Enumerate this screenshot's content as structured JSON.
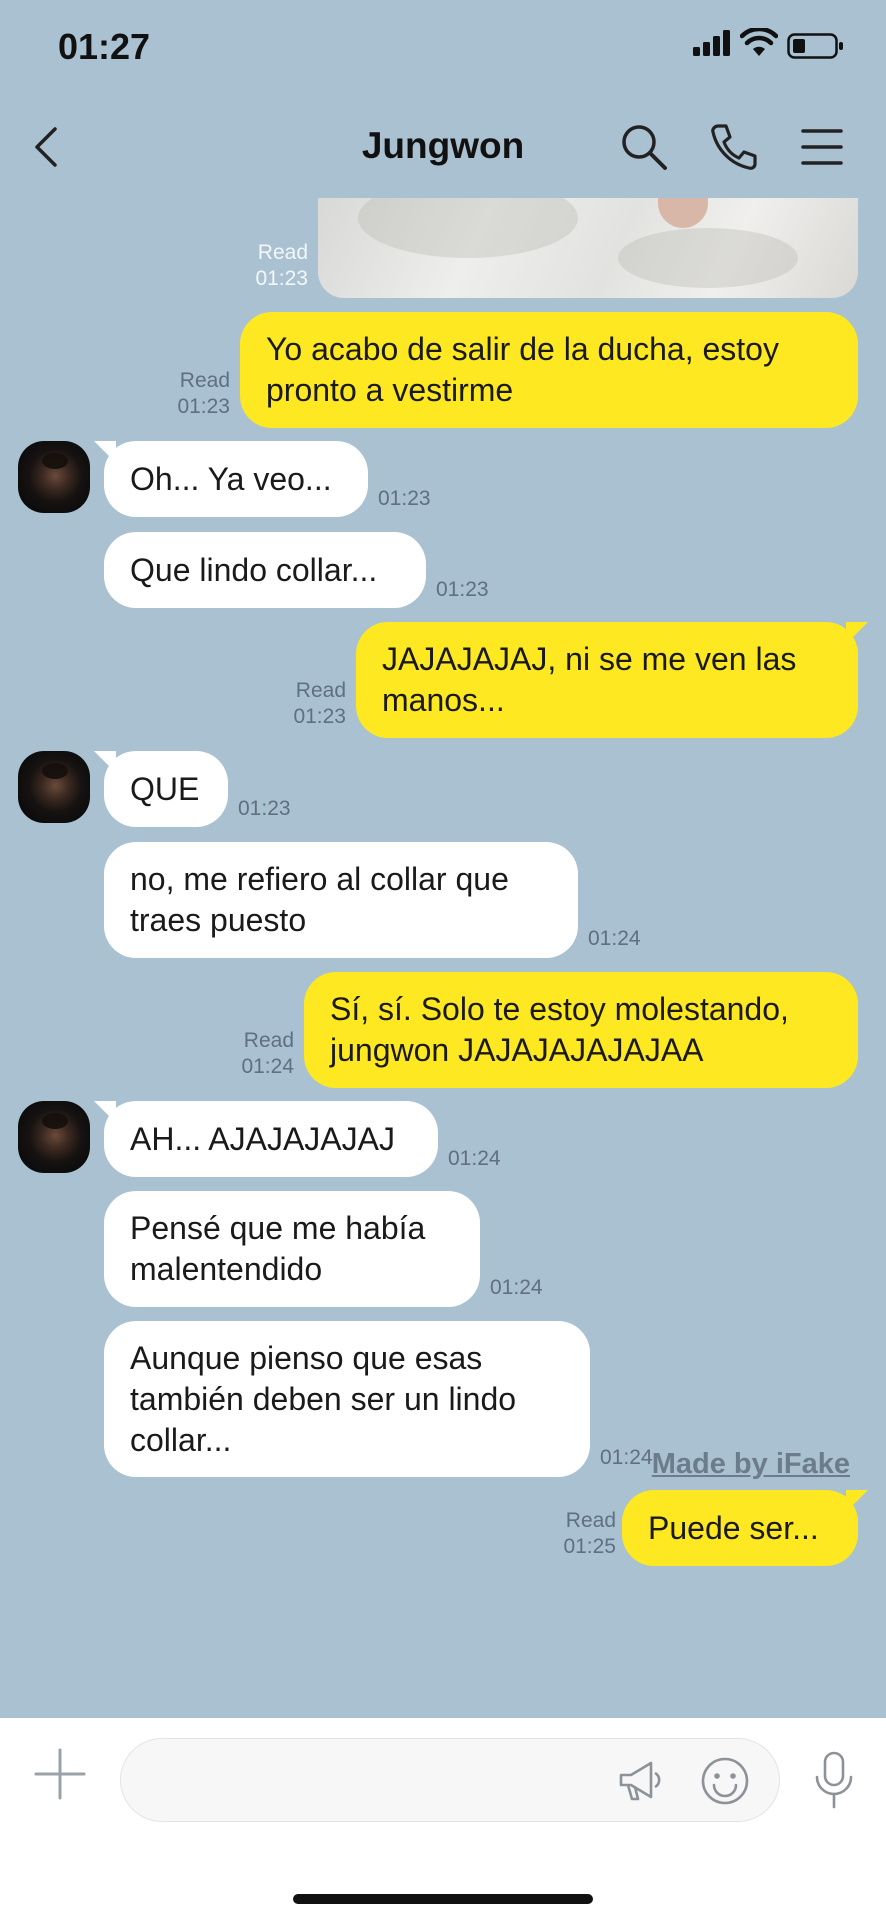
{
  "status_bar": {
    "time": "01:27"
  },
  "header": {
    "contact_name": "Jungwon"
  },
  "messages": [
    {
      "dir": "out",
      "type": "photo",
      "read": "Read",
      "time": "01:23"
    },
    {
      "dir": "out",
      "text": "Yo acabo de salir de la ducha, estoy pronto a vestirme",
      "read": "Read",
      "time": "01:23"
    },
    {
      "dir": "in",
      "text": "Oh... Ya veo...",
      "time": "01:23"
    },
    {
      "dir": "in",
      "text": "Que lindo collar...",
      "time": "01:23"
    },
    {
      "dir": "out",
      "text": "JAJAJAJAJ, ni se me ven las manos...",
      "read": "Read",
      "time": "01:23"
    },
    {
      "dir": "in",
      "text": "QUE",
      "time": "01:23"
    },
    {
      "dir": "in",
      "text": "no, me refiero al collar que traes puesto",
      "time": "01:24"
    },
    {
      "dir": "out",
      "text": "Sí, sí. Solo te estoy molestando, jungwon JAJAJAJAJAJAA",
      "read": "Read",
      "time": "01:24"
    },
    {
      "dir": "in",
      "text": "AH... AJAJAJAJAJ",
      "time": "01:24"
    },
    {
      "dir": "in",
      "text": "Pensé que me había malentendido",
      "time": "01:24"
    },
    {
      "dir": "in",
      "text": "Aunque pienso que esas también deben ser un lindo collar...",
      "time": "01:24"
    },
    {
      "dir": "out",
      "text": "Puede ser...",
      "read": "Read",
      "time": "01:25"
    }
  ],
  "watermark": "Made by iFake",
  "icons": {
    "back": "chevron-left-icon",
    "search": "search-icon",
    "call": "phone-icon",
    "menu": "menu-icon",
    "attach": "plus-icon",
    "megaphone": "megaphone-icon",
    "emoji": "emoji-icon",
    "mic": "microphone-icon"
  },
  "colors": {
    "background": "#aac1d2",
    "outgoing_bubble": "#fde821",
    "incoming_bubble": "#ffffff"
  }
}
